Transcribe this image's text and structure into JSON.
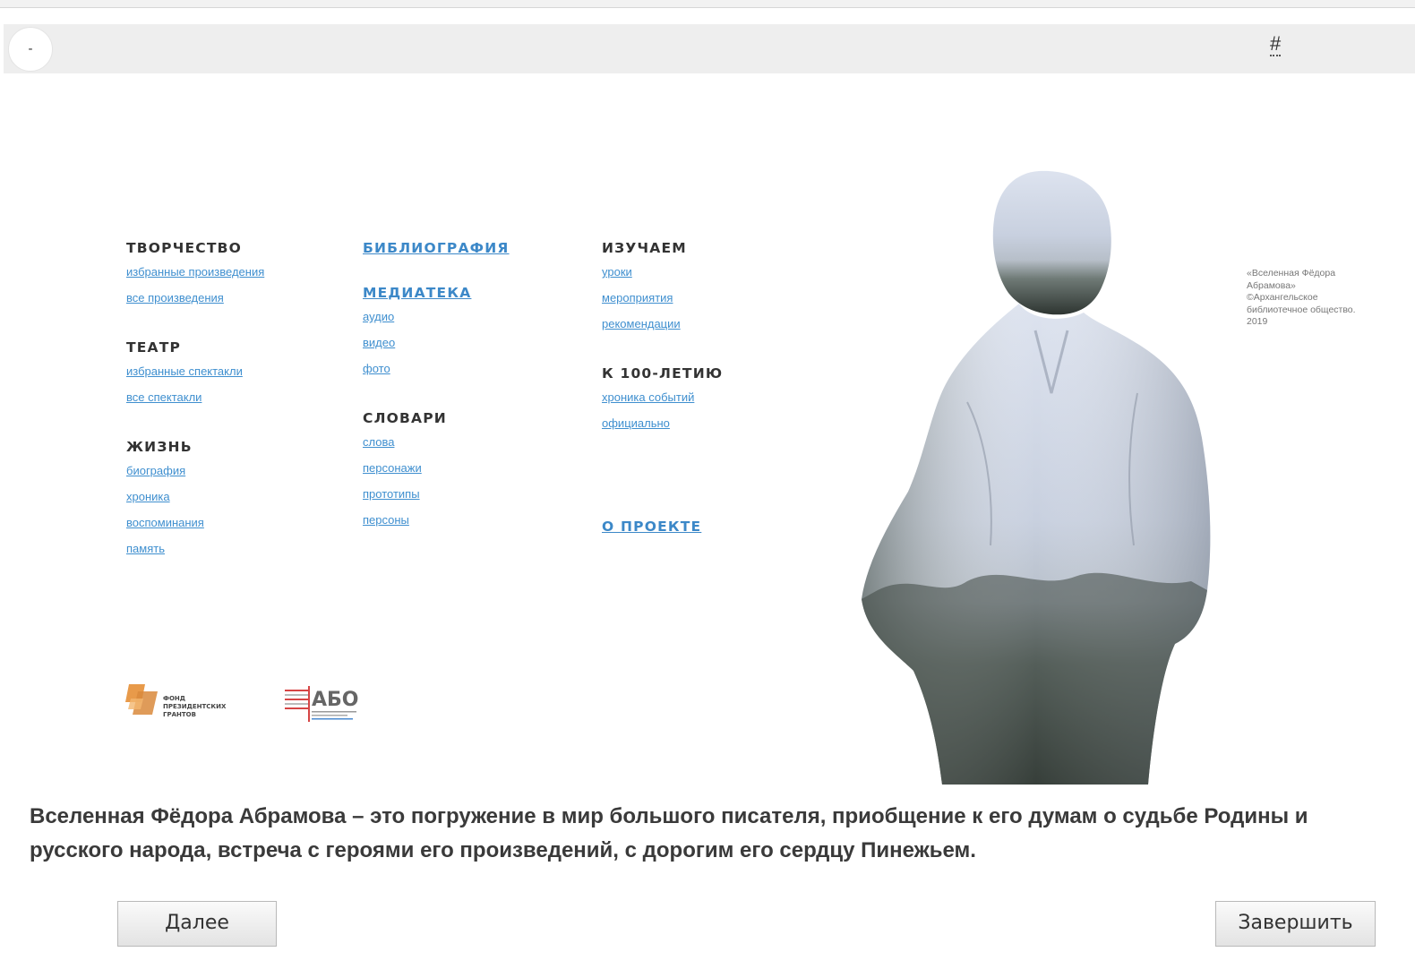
{
  "toolbar": {
    "back_label": "-",
    "hash_label": "#"
  },
  "menu": {
    "col1": [
      {
        "heading": "ТВОРЧЕСТВО",
        "links": [
          "избранные произведения",
          "все произведения"
        ]
      },
      {
        "heading": "ТЕАТР",
        "links": [
          "избранные спектакли",
          "все спектакли"
        ]
      },
      {
        "heading": "ЖИЗНЬ",
        "links": [
          "биография",
          "хроника",
          "воспоминания",
          "память"
        ]
      }
    ],
    "col2": [
      {
        "heading": "БИБЛИОГРАФИЯ",
        "links": []
      },
      {
        "heading": "МЕДИАТЕКА",
        "links": [
          "аудио",
          "видео",
          "фото"
        ]
      },
      {
        "heading": "СЛОВАРИ",
        "links": [
          "слова",
          "персонажи",
          "прототипы",
          "персоны"
        ]
      }
    ],
    "col3": [
      {
        "heading": "ИЗУЧАЕМ",
        "links": [
          "уроки",
          "мероприятия",
          "рекомендации"
        ]
      },
      {
        "heading": "К 100-ЛЕТИЮ",
        "links": [
          "хроника событий",
          "официально"
        ]
      },
      {
        "heading": "О ПРОЕКТЕ",
        "links": []
      }
    ]
  },
  "logos": {
    "fpg_line1": "ФОНД",
    "fpg_line2": "ПРЕЗИДЕНТСКИХ",
    "fpg_line3": "ГРАНТОВ",
    "abo_text": "АБО"
  },
  "caption": {
    "line1": "«Вселенная Фёдора",
    "line2": "Абрамова»",
    "line3": "©Архангельское",
    "line4": "библиотечное общество.",
    "line5": "2019"
  },
  "description": "Вселенная Фёдора Абрамова – это погружение в мир большого писателя, приобщение к его думам о судьбе Родины и русского народа, встреча с героями его произведений, с дорогим его сердцу Пинежьем.",
  "buttons": {
    "next": "Далее",
    "finish": "Завершить"
  },
  "colors": {
    "link": "#3f8fcf",
    "heading": "#333333",
    "toolbar_bg": "#eeeeee",
    "fpg_orange": "#e89a4a",
    "abo_red": "#d64545"
  }
}
